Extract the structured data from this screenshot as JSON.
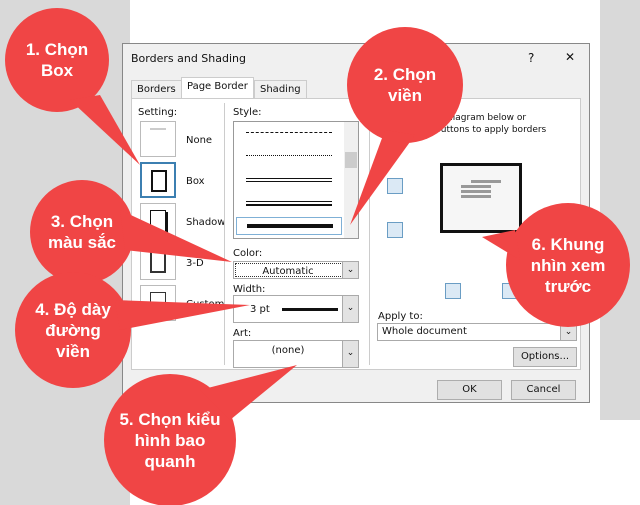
{
  "dialog": {
    "title": "Borders and Shading",
    "help": "?",
    "close": "✕",
    "tabs": [
      "Borders",
      "Page Border",
      "Shading"
    ],
    "setting_label": "Setting:",
    "settings": [
      "None",
      "Box",
      "Shadow",
      "3-D",
      "Custom"
    ],
    "style_label": "Style:",
    "color_label": "Color:",
    "color_value": "Automatic",
    "width_label": "Width:",
    "width_value": "3 pt",
    "art_label": "Art:",
    "art_value": "(none)",
    "preview_hint_1": "on diagram below or",
    "preview_hint_2": "se buttons to apply borders",
    "apply_label": "Apply to:",
    "apply_value": "Whole document",
    "options": "Options...",
    "ok": "OK",
    "cancel": "Cancel"
  },
  "callouts": [
    "1. Chọn Box",
    "2. Chọn viền",
    "3. Chọn màu sắc",
    "4. Độ dày đường viền",
    "5. Chọn kiểu hình bao quanh",
    "6. Khung nhìn xem trước"
  ],
  "colors": {
    "callout": "#f04545",
    "accent": "#3c7fb1"
  }
}
